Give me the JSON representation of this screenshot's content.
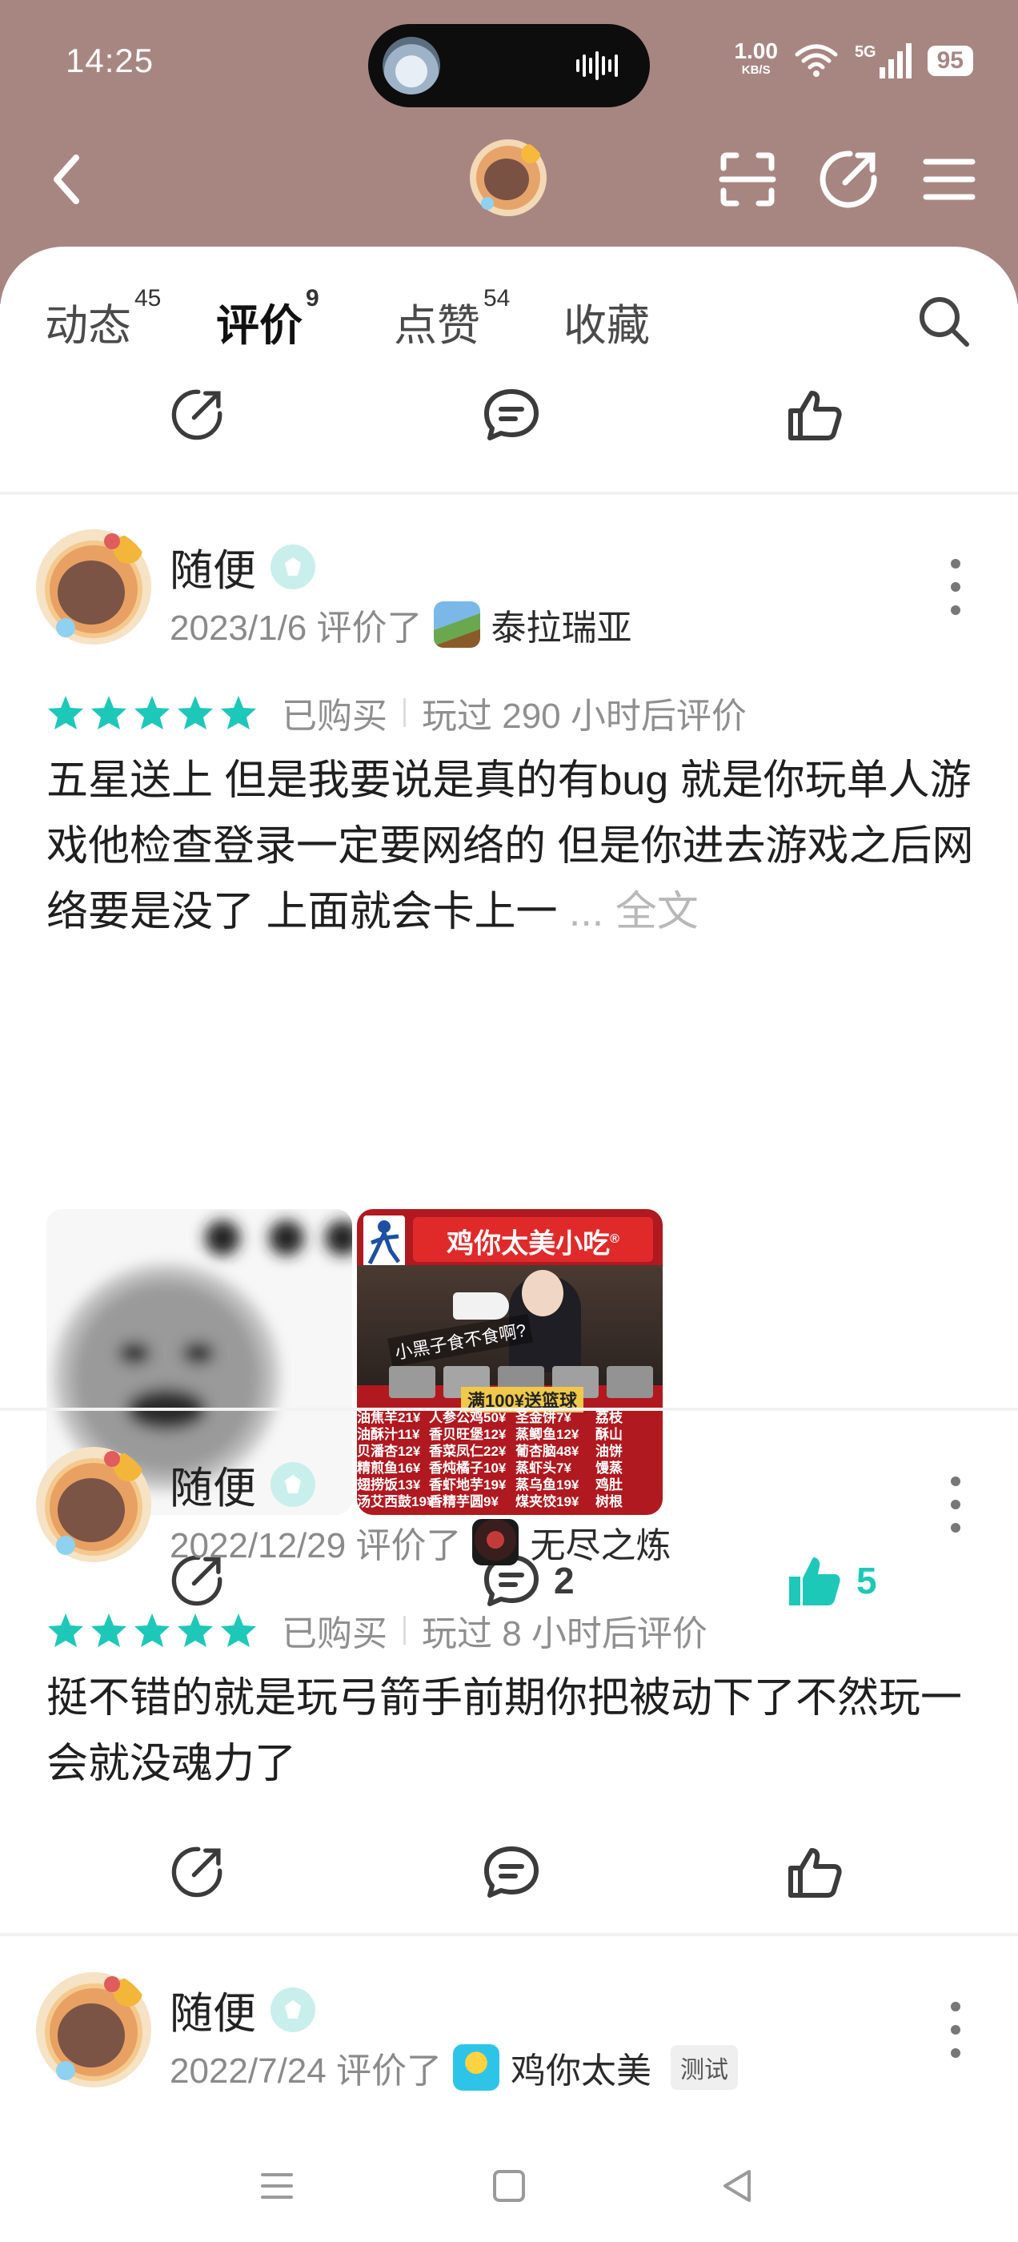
{
  "status": {
    "time": "14:25",
    "net_speed_value": "1.00",
    "net_speed_unit": "KB/S",
    "network_type": "5G",
    "battery": "95"
  },
  "tabs": [
    {
      "label": "动态",
      "count": "45"
    },
    {
      "label": "评价",
      "count": "9"
    },
    {
      "label": "点赞",
      "count": "54"
    },
    {
      "label": "收藏",
      "count": ""
    }
  ],
  "reviews": [
    {
      "author": "随便",
      "date": "2023/1/6 评价了",
      "game": "泰拉瑞亚",
      "rating": 5,
      "purchased": "已购买",
      "playtime": "玩过 290 小时后评价",
      "text": "五星送上 但是我要说是真的有bug 就是你玩单人游戏他检查登录一定要网络的 但是你进去游戏之后网络要是没了 上面就会卡上一",
      "more_text": "... 全文",
      "image2": {
        "title": "鸡你太美小吃",
        "slogan": "小黑子食不食啊?",
        "promo": "满100¥送篮球",
        "menu": [
          "油焦羊21¥",
          "人参公鸡50¥",
          "圣金饼7¥",
          "荔枝",
          "油酥汁11¥",
          "香贝旺堡12¥",
          "蒸鲫鱼12¥",
          "酥山",
          "贝潘杏12¥",
          "香菜凤仁22¥",
          "葡杏脑48¥",
          "油饼",
          "精煎鱼16¥",
          "香炖橘子10¥",
          "蒸虾头7¥",
          "馒蒸",
          "翅捞饭13¥",
          "香虾地芋19¥",
          "蒸乌鱼19¥",
          "鸡肚",
          "汤艾西鼓19¥",
          "香精芋圆9¥",
          "煤夹饺19¥",
          "树根"
        ]
      },
      "comments": "2",
      "likes": "5"
    },
    {
      "author": "随便",
      "date": "2022/12/29 评价了",
      "game": "无尽之炼",
      "rating": 5,
      "purchased": "已购买",
      "playtime": "玩过 8 小时后评价",
      "text": "挺不错的就是玩弓箭手前期你把被动下了不然玩一会就没魂力了"
    },
    {
      "author": "随便",
      "date": "2022/7/24 评价了",
      "game": "鸡你太美",
      "tag": "测试"
    }
  ],
  "colors": {
    "header_bg": "#a78682",
    "accent": "#1ec8b8",
    "star": "#1ec8b8"
  }
}
